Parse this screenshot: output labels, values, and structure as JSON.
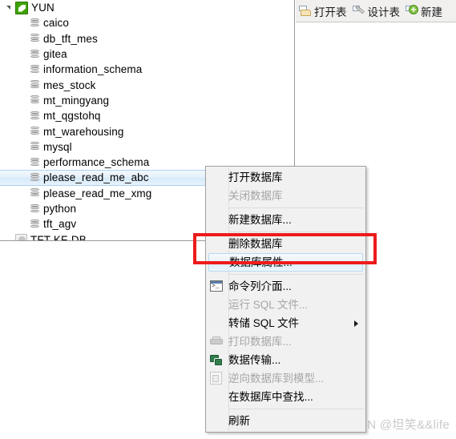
{
  "tree": {
    "root": {
      "label": "YUN",
      "icon": "mysql-connection-icon",
      "expanded": true
    },
    "items": [
      {
        "label": "caico",
        "icon": "database-icon"
      },
      {
        "label": "db_tft_mes",
        "icon": "database-icon"
      },
      {
        "label": "gitea",
        "icon": "database-icon"
      },
      {
        "label": "information_schema",
        "icon": "database-icon"
      },
      {
        "label": "mes_stock",
        "icon": "database-icon"
      },
      {
        "label": "mt_mingyang",
        "icon": "database-icon"
      },
      {
        "label": "mt_qgstohq",
        "icon": "database-icon"
      },
      {
        "label": "mt_warehousing",
        "icon": "database-icon"
      },
      {
        "label": "mysql",
        "icon": "database-icon"
      },
      {
        "label": "performance_schema",
        "icon": "database-icon"
      },
      {
        "label": "please_read_me_abc",
        "icon": "database-icon",
        "selected": true
      },
      {
        "label": "please_read_me_xmg",
        "icon": "database-icon"
      },
      {
        "label": "python",
        "icon": "database-icon"
      },
      {
        "label": "tft_agv",
        "icon": "database-icon"
      }
    ],
    "second_connection": {
      "label": "TFT-KF-DB",
      "icon": "postgres-connection-icon"
    }
  },
  "toolbar": {
    "buttons": [
      {
        "label": "打开表",
        "icon": "open-table-icon"
      },
      {
        "label": "设计表",
        "icon": "design-table-icon"
      },
      {
        "label": "新建",
        "icon": "new-table-icon"
      }
    ]
  },
  "context_menu": {
    "items": [
      {
        "label": "打开数据库",
        "disabled": false,
        "icon": null,
        "submenu": false
      },
      {
        "label": "关闭数据库",
        "disabled": true,
        "icon": null,
        "submenu": false
      },
      {
        "separator": true
      },
      {
        "label": "新建数据库...",
        "disabled": false,
        "icon": null,
        "submenu": false
      },
      {
        "separator": true
      },
      {
        "label": "删除数据库",
        "disabled": false,
        "icon": null,
        "submenu": false
      },
      {
        "label": "数据库属性...",
        "disabled": false,
        "icon": null,
        "submenu": false,
        "highlighted": true
      },
      {
        "separator": true
      },
      {
        "label": "命令列介面...",
        "disabled": false,
        "icon": "command-line-icon",
        "submenu": false
      },
      {
        "label": "运行 SQL 文件...",
        "disabled": true,
        "icon": null,
        "submenu": false
      },
      {
        "label": "转储 SQL 文件",
        "disabled": false,
        "icon": null,
        "submenu": true
      },
      {
        "label": "打印数据库...",
        "disabled": true,
        "icon": "print-icon",
        "submenu": false
      },
      {
        "label": "数据传输...",
        "disabled": false,
        "icon": "data-transfer-icon",
        "submenu": false
      },
      {
        "label": "逆向数据库到模型...",
        "disabled": true,
        "icon": "reverse-model-icon",
        "submenu": false
      },
      {
        "label": "在数据库中查找...",
        "disabled": false,
        "icon": null,
        "submenu": false
      },
      {
        "separator": true
      },
      {
        "label": "刷新",
        "disabled": false,
        "icon": null,
        "submenu": false
      }
    ]
  },
  "annotation": {
    "color": "#ee1b1b"
  },
  "watermark": {
    "text": "CSDN @坦笑&&life"
  }
}
